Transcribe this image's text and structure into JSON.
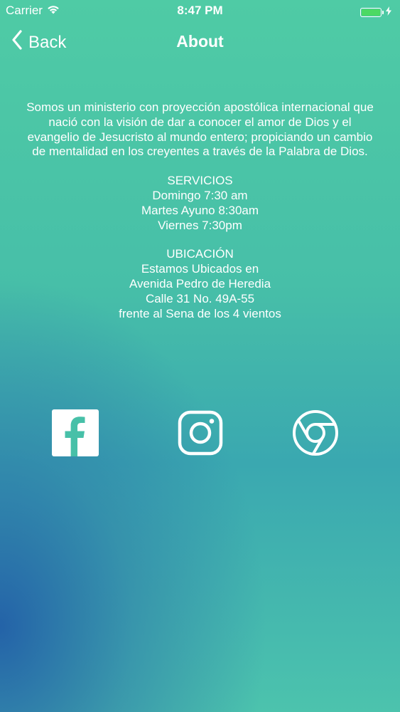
{
  "status_bar": {
    "carrier": "Carrier",
    "time": "8:47 PM",
    "battery_color": "#4cd964"
  },
  "nav": {
    "back_label": "Back",
    "title": "About"
  },
  "about": {
    "description": "Somos un ministerio con proyección apostólica internacional que nació con la visión de dar a conocer el amor de Dios y el evangelio de Jesucristo al mundo entero; propiciando un cambio de mentalidad en los creyentes a través de la Palabra de Dios.",
    "services": {
      "heading": "SERVICIOS",
      "lines": [
        "Domingo 7:30 am",
        "Martes Ayuno 8:30am",
        "Viernes 7:30pm"
      ]
    },
    "location": {
      "heading": "UBICACIÓN",
      "lines": [
        "Estamos Ubicados en",
        "Avenida Pedro de Heredia",
        "Calle 31 No. 49A-55",
        "frente al Sena de los 4 vientos"
      ]
    }
  },
  "social": {
    "icons": [
      "facebook-icon",
      "instagram-icon",
      "chrome-icon"
    ]
  }
}
